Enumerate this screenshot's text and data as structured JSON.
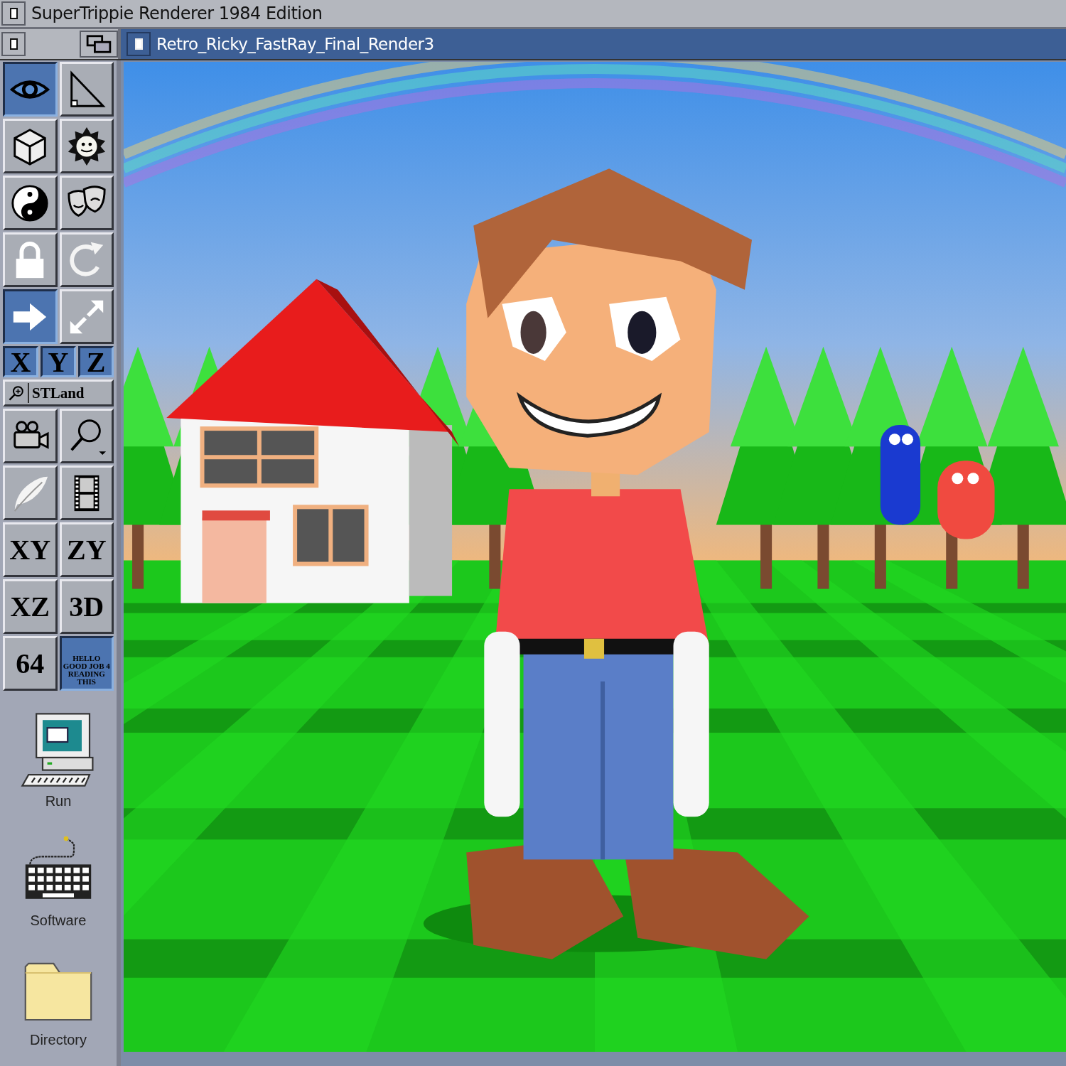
{
  "app_title_bar": {
    "title": "SuperTrippie Renderer 1984 Edition"
  },
  "render_window": {
    "title": "Retro_Ricky_FastRay_Final_Render3"
  },
  "top_tools": [
    {
      "selected": true
    },
    {
      "selected": false
    },
    {
      "selected": false
    },
    {
      "selected": false
    },
    {
      "selected": false
    },
    {
      "selected": false
    },
    {
      "selected": false
    },
    {
      "selected": false
    },
    {
      "selected": true
    },
    {
      "selected": false
    }
  ],
  "axis_buttons": [
    {
      "label": "X",
      "selected": true
    },
    {
      "label": "Y",
      "selected": true
    },
    {
      "label": "Z",
      "selected": true
    }
  ],
  "stland_button": {
    "label": "STLand"
  },
  "lower_tools": [
    {
      "selected": false
    },
    {
      "selected": false
    },
    {
      "selected": false
    },
    {
      "selected": false
    }
  ],
  "view_buttons": [
    {
      "label": "XY",
      "selected": false
    },
    {
      "label": "ZY",
      "selected": false
    },
    {
      "label": "XZ",
      "selected": false
    },
    {
      "label": "3D",
      "selected": false
    },
    {
      "label": "64",
      "selected": false
    },
    {
      "label": "HELLO GOOD JOB 4 READING THIS",
      "selected": true
    }
  ],
  "desktop_icons": [
    {
      "label": "Run"
    },
    {
      "label": "Software"
    },
    {
      "label": "Directory"
    }
  ]
}
